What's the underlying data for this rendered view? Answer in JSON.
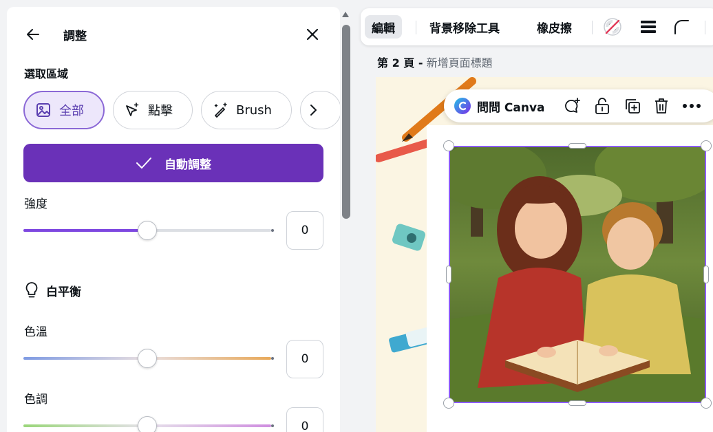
{
  "panel": {
    "title": "調整",
    "selection_label": "選取區域",
    "chips": [
      {
        "label": "全部",
        "icon": "image-icon",
        "active": true
      },
      {
        "label": "點擊",
        "icon": "click-sparkle-icon",
        "active": false
      },
      {
        "label": "Brush",
        "icon": "magic-brush-icon",
        "active": false
      }
    ],
    "auto_adjust_label": "自動調整",
    "intensity": {
      "label": "強度",
      "value_text": "0",
      "level_percent": 50
    },
    "white_balance": {
      "label": "白平衡"
    },
    "temperature": {
      "label": "色溫",
      "value_text": "0",
      "level_percent": 50
    },
    "tint": {
      "label": "色調",
      "value_text": "0",
      "level_percent": 50
    }
  },
  "toolbar": {
    "edit": "編輯",
    "bg_remover": "背景移除工具",
    "eraser": "橡皮擦"
  },
  "page": {
    "number_label": "第 2 頁 -",
    "title_placeholder": "新增頁面標題"
  },
  "float_bar": {
    "ask_canva": "問問 Canva"
  },
  "colors": {
    "accent": "#6a31b8",
    "selected_border": "#8b5cf6"
  }
}
